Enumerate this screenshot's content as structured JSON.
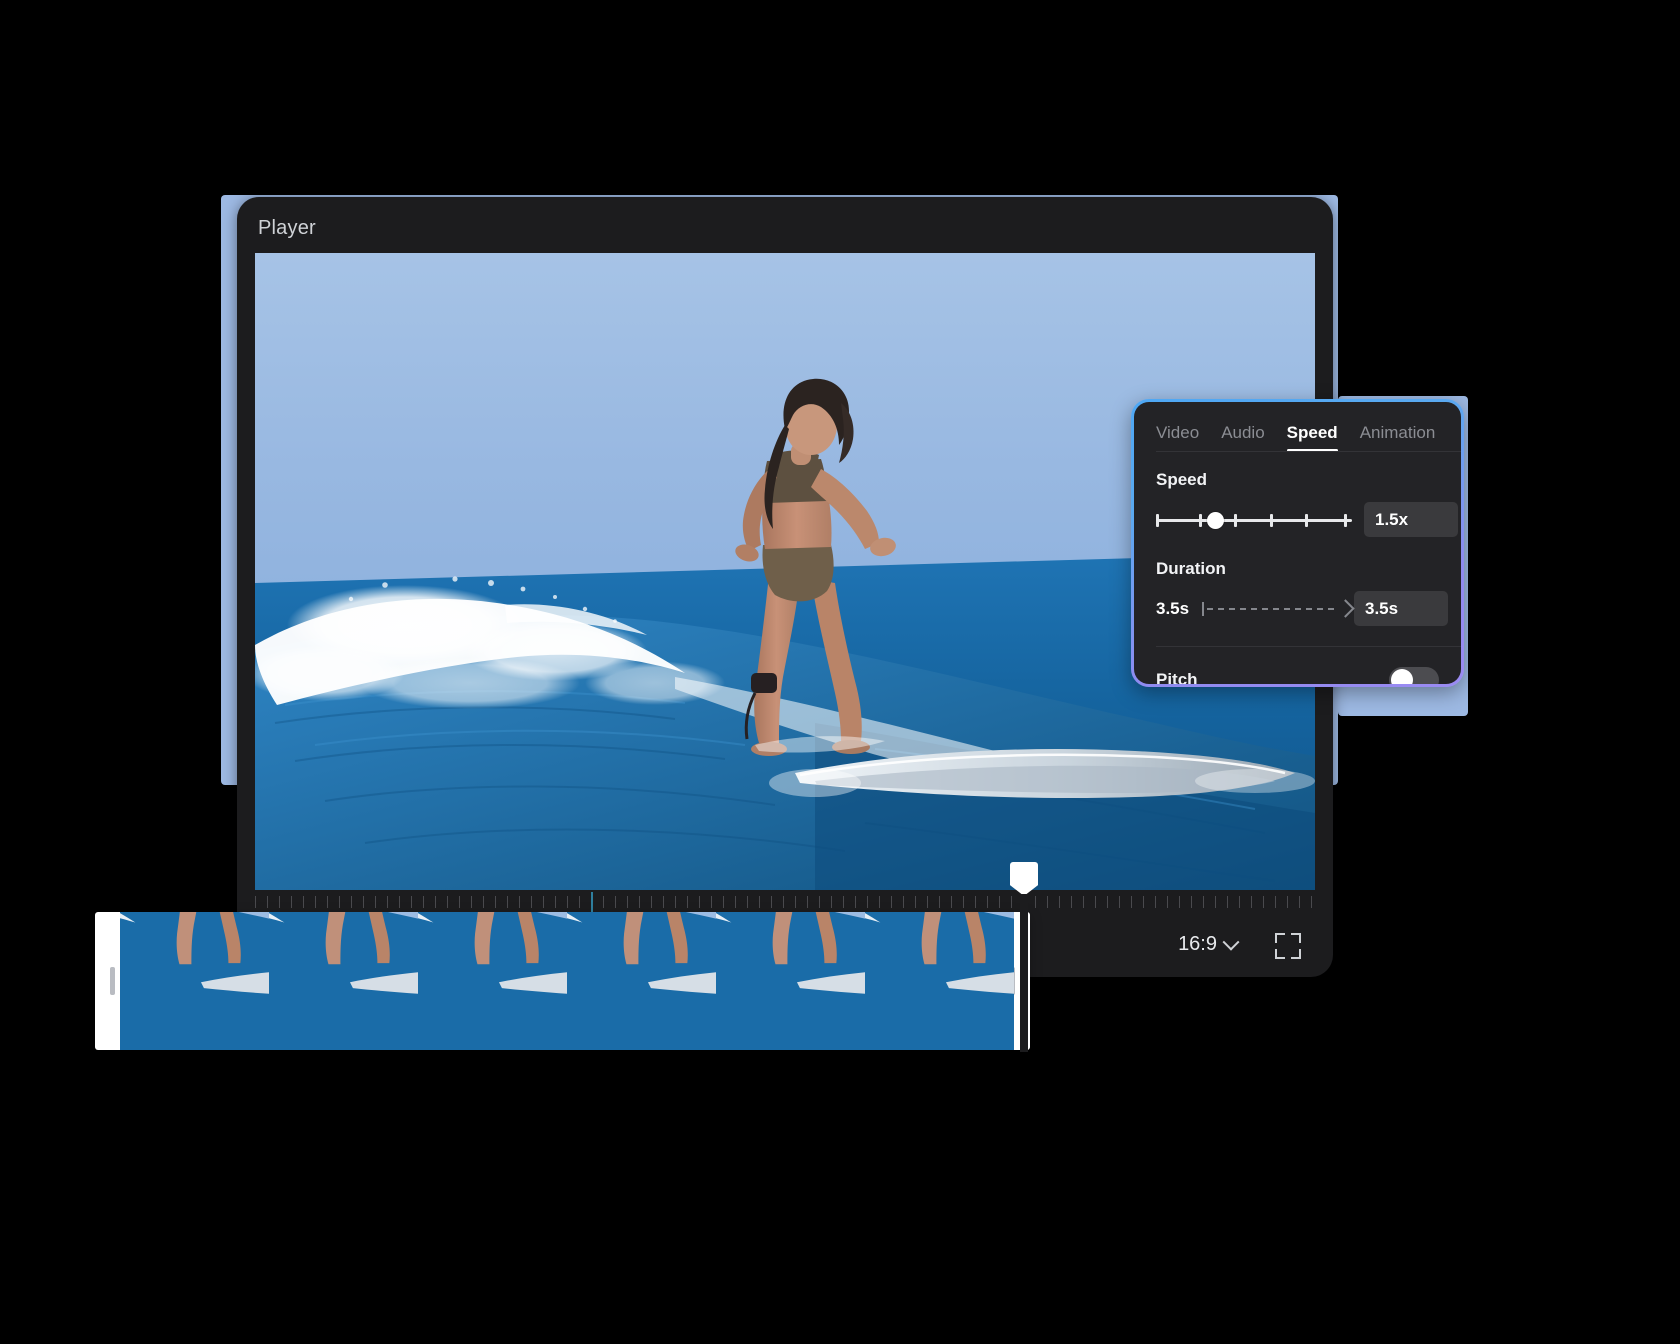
{
  "window": {
    "title": "Player"
  },
  "video": {
    "scene_description": "surfer riding a wave",
    "colors": {
      "sky": "#9cbce3",
      "ocean_deep": "#15659f",
      "ocean_mid": "#2a7fc0",
      "foam": "#f2f6fb",
      "skin": "#c0907a",
      "swimsuit": "#6b5a46",
      "hair": "#2c2420",
      "board": "#dfe5ea"
    }
  },
  "bottom_bar": {
    "aspect_ratio": "16:9",
    "aspect_chevron_icon": "chevron-down-icon",
    "fullscreen_icon": "fullscreen-icon"
  },
  "panel": {
    "tabs": [
      {
        "label": "Video",
        "active": false
      },
      {
        "label": "Audio",
        "active": false
      },
      {
        "label": "Speed",
        "active": true
      },
      {
        "label": "Animation",
        "active": false
      }
    ],
    "speed": {
      "label": "Speed",
      "value": "1.5x",
      "slider_position_pct": 28,
      "tick_positions_pct": [
        0,
        22,
        40,
        58,
        76,
        94
      ]
    },
    "duration": {
      "label": "Duration",
      "start_value": "3.5s",
      "end_value": "3.5s"
    },
    "pitch": {
      "label": "Pitch",
      "enabled": false
    },
    "accent_gradient_start": "#4ea8f5",
    "accent_gradient_end": "#9b8bf2"
  },
  "timeline": {
    "ruler_tick_color": "#4a4a4e",
    "playhead_color": "#2f7f9e",
    "clip_count": 6,
    "trim_handles": [
      "trim-handle-left",
      "trim-handle-right"
    ]
  }
}
